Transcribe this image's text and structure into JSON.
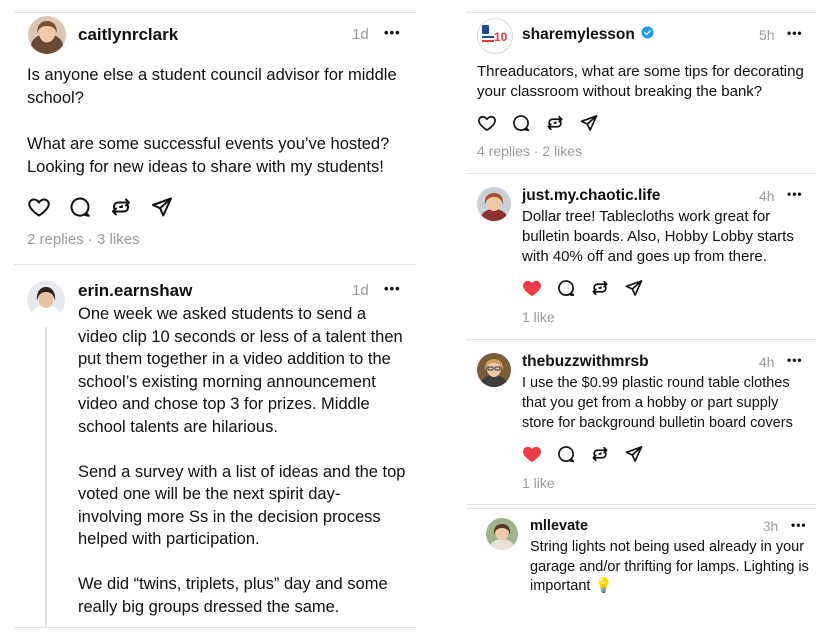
{
  "left_thread": {
    "post1": {
      "username": "caitlynrclark",
      "time": "1d",
      "text": "Is anyone else a student council advisor for middle school?\n\nWhat are some successful events you’ve hosted? Looking for new ideas to share with my students!",
      "replies": "2 replies",
      "likes": "3 likes"
    },
    "reply1": {
      "username": "erin.earnshaw",
      "time": "1d",
      "text": "One week we asked students to send a video clip 10 seconds or less of a talent then put them together in a video addition to the school’s existing morning announcement video and chose top 3 for prizes. Middle school talents are hilarious.\n\nSend a survey with a list of ideas and the top voted one will be the next spirit day- involving more Ss in the decision process helped with participation.\n\nWe did “twins, triplets, plus” day and some really big groups dressed the same."
    }
  },
  "right_thread": {
    "post1": {
      "username": "sharemylesson",
      "avatar_text": "10",
      "time": "5h",
      "text": "Threaducators, what are some tips for decorating your classroom without breaking the bank?",
      "replies": "4 replies",
      "likes": "2 likes"
    },
    "reply1": {
      "username": "just.my.chaotic.life",
      "time": "4h",
      "text": "Dollar tree! Tablecloths work great for bulletin boards. Also, Hobby Lobby starts with 40% off and goes up from there.",
      "likes": "1 like"
    },
    "reply2": {
      "username": "thebuzzwithmrsb",
      "time": "4h",
      "text": "I use the $0.99 plastic round table clothes that you get from a hobby or part supply store for background bulletin board covers",
      "likes": "1 like"
    },
    "reply3": {
      "username": "mllevate",
      "time": "3h",
      "text": "String lights not being used already in your garage and/or thrifting for lamps. Lighting is important 💡"
    }
  },
  "more_label": "•••",
  "stats_separator": " · ",
  "colors": {
    "text": "#101010",
    "muted": "#9a9a9a",
    "divider": "#e3e3e3",
    "like_red": "#ee3b45",
    "verified_blue": "#1d9bf0"
  },
  "icons": [
    "heart-icon",
    "comment-icon",
    "repost-icon",
    "share-icon",
    "more-icon",
    "verified-badge-icon",
    "lightbulb-emoji"
  ]
}
